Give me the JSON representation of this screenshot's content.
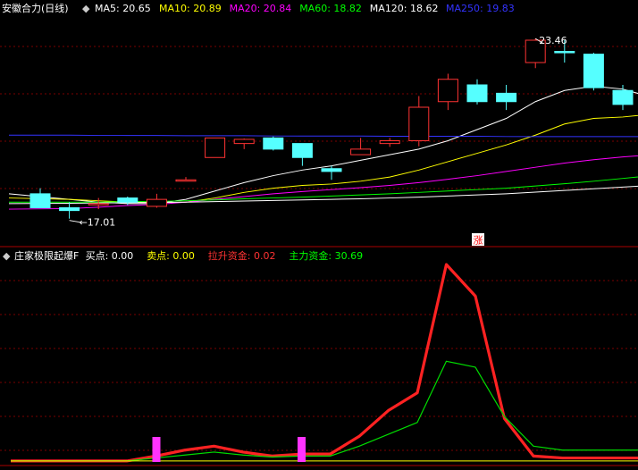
{
  "chart_data": [
    {
      "type": "candlestick",
      "header": {
        "title": "安徽合力(日线)",
        "ma_items": [
          {
            "label": "MA5: 20.65",
            "color": "#ffffff"
          },
          {
            "label": "MA10: 20.89",
            "color": "#ffff00"
          },
          {
            "label": "MA20: 20.84",
            "color": "#ff00ff"
          },
          {
            "label": "MA60: 18.82",
            "color": "#00ff00"
          },
          {
            "label": "MA120: 18.62",
            "color": "#ffffff"
          },
          {
            "label": "MA250: 19.83",
            "color": "#3333ff"
          }
        ]
      },
      "ylim": [
        16.2,
        24.2
      ],
      "colors": {
        "up": "#ff3333",
        "down": "#55ffff"
      },
      "candles": [
        {
          "o": 17.9,
          "h": 18.1,
          "l": 17.4,
          "c": 17.4
        },
        {
          "o": 17.4,
          "h": 17.6,
          "l": 17.01,
          "c": 17.3
        },
        {
          "o": 17.55,
          "h": 17.75,
          "l": 17.35,
          "c": 17.55
        },
        {
          "o": 17.75,
          "h": 17.8,
          "l": 17.5,
          "c": 17.6
        },
        {
          "o": 17.45,
          "h": 17.9,
          "l": 17.4,
          "c": 17.7
        },
        {
          "o": 18.4,
          "h": 18.5,
          "l": 18.4,
          "c": 18.4
        },
        {
          "o": 19.2,
          "h": 19.9,
          "l": 19.2,
          "c": 19.9
        },
        {
          "o": 19.7,
          "h": 19.88,
          "l": 19.5,
          "c": 19.85
        },
        {
          "o": 19.9,
          "h": 19.95,
          "l": 19.45,
          "c": 19.5
        },
        {
          "o": 19.7,
          "h": 19.7,
          "l": 18.9,
          "c": 19.2
        },
        {
          "o": 18.8,
          "h": 18.9,
          "l": 18.4,
          "c": 18.7
        },
        {
          "o": 19.3,
          "h": 19.9,
          "l": 19.3,
          "c": 19.5
        },
        {
          "o": 19.7,
          "h": 19.9,
          "l": 19.58,
          "c": 19.8
        },
        {
          "o": 19.8,
          "h": 21.4,
          "l": 19.6,
          "c": 21.0
        },
        {
          "o": 21.2,
          "h": 22.2,
          "l": 20.9,
          "c": 22.0
        },
        {
          "o": 21.8,
          "h": 22.0,
          "l": 21.1,
          "c": 21.2
        },
        {
          "o": 21.5,
          "h": 21.8,
          "l": 20.9,
          "c": 21.2
        },
        {
          "o": 22.6,
          "h": 23.46,
          "l": 22.4,
          "c": 23.4
        },
        {
          "o": 23.0,
          "h": 23.4,
          "l": 22.6,
          "c": 22.95
        },
        {
          "o": 22.9,
          "h": 22.95,
          "l": 21.6,
          "c": 21.7
        },
        {
          "o": 21.6,
          "h": 21.8,
          "l": 20.9,
          "c": 21.1
        },
        {
          "o": 20.9,
          "h": 21.1,
          "l": 20.5,
          "c": 21.1
        },
        {
          "o": 20.9,
          "h": 21.4,
          "l": 20.7,
          "c": 21.3
        }
      ],
      "ma_lines": [
        {
          "color": "#ffffff",
          "values": [
            17.9,
            17.7,
            17.6,
            17.55,
            17.55,
            17.7,
            18.0,
            18.3,
            18.55,
            18.75,
            18.9,
            19.1,
            19.3,
            19.5,
            19.8,
            20.2,
            20.6,
            21.2,
            21.6,
            21.75,
            21.65,
            21.35,
            21.1
          ]
        },
        {
          "color": "#ffff00",
          "values": [
            17.75,
            17.7,
            17.65,
            17.6,
            17.58,
            17.6,
            17.75,
            17.95,
            18.1,
            18.2,
            18.25,
            18.35,
            18.5,
            18.75,
            19.05,
            19.35,
            19.65,
            20.0,
            20.4,
            20.6,
            20.65,
            20.75,
            20.85
          ]
        },
        {
          "color": "#ff00ff",
          "values": [
            17.35,
            17.37,
            17.42,
            17.48,
            17.52,
            17.6,
            17.7,
            17.8,
            17.9,
            17.98,
            18.05,
            18.12,
            18.2,
            18.3,
            18.42,
            18.55,
            18.7,
            18.85,
            19.0,
            19.12,
            19.22,
            19.3,
            19.4
          ]
        },
        {
          "color": "#00ff00",
          "values": [
            17.6,
            17.6,
            17.6,
            17.62,
            17.63,
            17.65,
            17.68,
            17.72,
            17.75,
            17.78,
            17.82,
            17.86,
            17.9,
            17.95,
            18.0,
            18.05,
            18.1,
            18.18,
            18.26,
            18.35,
            18.45,
            18.55,
            18.65
          ]
        },
        {
          "color": "#ffffff",
          "values": [
            17.55,
            17.56,
            17.57,
            17.58,
            17.59,
            17.6,
            17.62,
            17.64,
            17.66,
            17.68,
            17.7,
            17.72,
            17.75,
            17.78,
            17.82,
            17.86,
            17.9,
            17.96,
            18.02,
            18.08,
            18.14,
            18.2,
            18.25
          ]
        },
        {
          "color": "#3333ff",
          "values": [
            20.0,
            20.0,
            19.99,
            19.99,
            19.99,
            19.98,
            19.98,
            19.98,
            19.97,
            19.97,
            19.97,
            19.97,
            19.96,
            19.96,
            19.96,
            19.96,
            19.95,
            19.95,
            19.95,
            19.95,
            19.95,
            19.95,
            19.95
          ]
        }
      ],
      "annotations": {
        "high": "23.46",
        "low": "17.01",
        "limit_up": "涨"
      }
    },
    {
      "type": "line",
      "header": {
        "items": [
          {
            "label": "庄家极限起爆F",
            "color": "#ffffff"
          },
          {
            "label": "买点: 0.00",
            "color": "#ffffff"
          },
          {
            "label": "卖点: 0.00",
            "color": "#ffff00"
          },
          {
            "label": "拉升资金: 0.02",
            "color": "#ff3333"
          },
          {
            "label": "主力资金: 30.69",
            "color": "#00ff00"
          }
        ]
      },
      "ylim": [
        0,
        100
      ],
      "series": [
        {
          "color": "#ff2222",
          "width": 3.2,
          "values": [
            0.5,
            0.5,
            0.5,
            0.5,
            0.5,
            3,
            6,
            8,
            5,
            3,
            4,
            4,
            13,
            26,
            35,
            100,
            84,
            22,
            3,
            2,
            2
          ]
        },
        {
          "color": "#00dd00",
          "width": 1.2,
          "values": [
            0.5,
            0.5,
            0.5,
            0.5,
            0.5,
            2,
            3.5,
            5,
            3.5,
            2.5,
            3,
            3,
            8,
            14,
            20,
            51,
            48,
            23,
            8,
            6,
            6
          ]
        },
        {
          "color": "#ffff00",
          "width": 1,
          "values": [
            0.5,
            0.5,
            0.5,
            0.5,
            0.5,
            0.5,
            0.5,
            0.5,
            0.5,
            0.5,
            0.5,
            0.5,
            0.5,
            0.5,
            0.5,
            0.5,
            0.5,
            0.5,
            0.5,
            0.5,
            0.5
          ]
        }
      ],
      "buy_signals": [
        5,
        10
      ],
      "signal_color": "#ff33ff"
    }
  ]
}
